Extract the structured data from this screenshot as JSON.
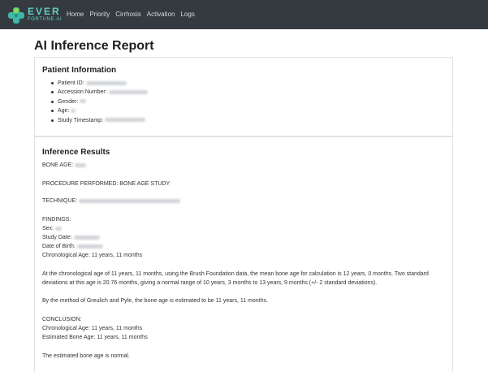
{
  "brand": {
    "name": "EVER",
    "tagline": "FORTUNE.AI"
  },
  "nav": [
    "Home",
    "Priority",
    "Cirrhosis",
    "Activation",
    "Logs"
  ],
  "page_title": "AI Inference Report",
  "patient_info": {
    "heading": "Patient Information",
    "fields": [
      "Patient ID:",
      "Accession Number:",
      "Gender:",
      "Age:",
      "Study Timestamp:"
    ]
  },
  "results": {
    "heading": "Inference Results",
    "bone_age_label": "BONE AGE:",
    "procedure": "PROCEDURE PERFORMED: BONE AGE STUDY",
    "technique_label": "TECHNIQUE:",
    "findings_label": "FINDINGS:",
    "sex_label": "Sex:",
    "study_date_label": "Study Date:",
    "dob_label": "Date of Birth:",
    "chronological_age": "Chronological Age: 11 years, 11 months",
    "paragraph_1": "At the chronological age of 11 years, 11 months, using the Brush Foundation data, the mean bone age for calculation is 12 years, 0 months. Two standard deviations at this age is 20.76 months, giving a normal range of 10 years, 3 months to 13 years, 9 months (+/- 2 standard deviations).",
    "paragraph_2": "By the method of Greulich and Pyle, the bone age is estimated to be 11 years, 11 months.",
    "conclusion_label": "CONCLUSION:",
    "conclusion_chrono": "Chronological Age: 11 years, 11 months",
    "conclusion_bone": "Estimated Bone Age: 11 years, 11 months",
    "summary": "The estimated bone age is normal."
  },
  "colors": {
    "navbar": "#343a40",
    "brand_accent": "#5fd0c4",
    "card_border": "#dfe2e6"
  },
  "icons": {
    "logo": "ever-fortune-logo-icon"
  }
}
